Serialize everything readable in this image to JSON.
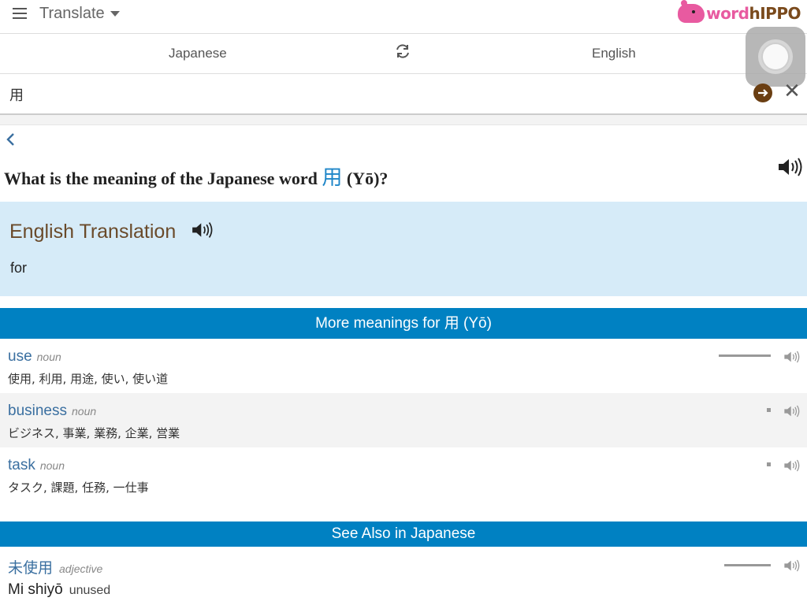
{
  "header": {
    "title": "Translate",
    "logo_word": "word",
    "logo_hippo": "hIPPO"
  },
  "languages": {
    "source": "Japanese",
    "target": "English"
  },
  "search": {
    "value": "用"
  },
  "question": {
    "prefix": "What is the meaning of the Japanese word",
    "word": "用",
    "suffix": "(Yō)?"
  },
  "translation": {
    "heading": "English Translation",
    "value": "for"
  },
  "more_meanings": {
    "header": "More meanings for 用 (Yō)",
    "items": [
      {
        "word": "use",
        "pos": "noun",
        "synonyms": "使用, 利用, 用途, 使い, 使い道",
        "frequency": 1.0
      },
      {
        "word": "business",
        "pos": "noun",
        "synonyms": "ビジネス, 事業, 業務, 企業, 営業",
        "frequency": 0.08
      },
      {
        "word": "task",
        "pos": "noun",
        "synonyms": "タスク, 課題, 任務, 一仕事",
        "frequency": 0.08
      }
    ]
  },
  "see_also": {
    "header": "See Also in Japanese",
    "items": [
      {
        "word": "未使用",
        "pos": "adjective",
        "romanization": "Mi shiyō",
        "meaning": "unused",
        "frequency": 0.9
      }
    ]
  },
  "icons": {
    "menu": "hamburger-icon",
    "swap": "swap-icon",
    "go": "arrow-right-circle-icon",
    "clear": "close-icon",
    "back": "chevron-left-icon",
    "speaker": "speaker-icon"
  },
  "colors": {
    "accent_blue": "#0081c2",
    "panel_blue": "#d6ebf8",
    "link_blue": "#3a6fa0",
    "brand_brown": "#6a3e12",
    "brand_pink": "#e85aa0"
  }
}
